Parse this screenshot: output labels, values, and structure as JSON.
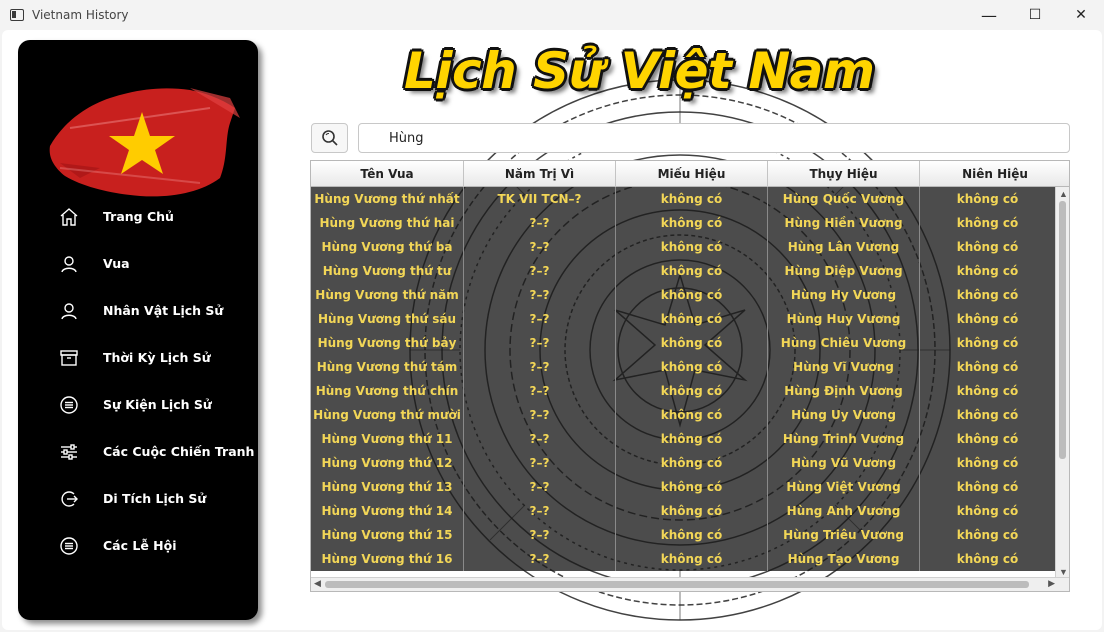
{
  "window": {
    "title": "Vietnam History",
    "minimize": "—",
    "maximize": "☐",
    "close": "✕"
  },
  "header": {
    "title": "Lịch Sử Việt Nam"
  },
  "sidebar": {
    "items": [
      {
        "label": "Trang Chủ",
        "icon": "home-icon"
      },
      {
        "label": "Vua",
        "icon": "user-icon"
      },
      {
        "label": "Nhân Vật Lịch Sử",
        "icon": "user-icon"
      },
      {
        "label": "Thời Kỳ Lịch Sử",
        "icon": "archive-icon"
      },
      {
        "label": "Sự Kiện Lịch Sử",
        "icon": "list-circle-icon"
      },
      {
        "label": "Các Cuộc Chiến Tranh",
        "icon": "sliders-icon"
      },
      {
        "label": "Di Tích Lịch Sử",
        "icon": "exit-circle-icon"
      },
      {
        "label": "Các Lễ Hội",
        "icon": "list-circle-icon"
      }
    ]
  },
  "search": {
    "value": "Hùng",
    "icon": "search-icon"
  },
  "table": {
    "columns": [
      "Tên Vua",
      "Năm Trị Vì",
      "Miếu Hiệu",
      "Thụy Hiệu",
      "Niên Hiệu"
    ],
    "rows": [
      [
        "Hùng Vương thứ nhất",
        "TK VII TCN–?",
        "không có",
        "Hùng Quốc Vương",
        "không có"
      ],
      [
        "Hùng Vương thứ hai",
        "?–?",
        "không có",
        "Hùng Hiền Vương",
        "không có"
      ],
      [
        "Hùng Vương thứ ba",
        "?–?",
        "không có",
        "Hùng Lân Vương",
        "không có"
      ],
      [
        "Hùng Vương thứ tư",
        "?–?",
        "không có",
        "Hùng Diệp Vương",
        "không có"
      ],
      [
        "Hùng Vương thứ năm",
        "?–?",
        "không có",
        "Hùng Hy Vương",
        "không có"
      ],
      [
        "Hùng Vương thứ sáu",
        "?–?",
        "không có",
        "Hùng Huy Vương",
        "không có"
      ],
      [
        "Hùng Vương thứ bảy",
        "?–?",
        "không có",
        "Hùng Chiêu Vương",
        "không có"
      ],
      [
        "Hùng Vương thứ tám",
        "?–?",
        "không có",
        "Hùng Vĩ Vương",
        "không có"
      ],
      [
        "Hùng Vương thứ chín",
        "?–?",
        "không có",
        "Hùng Định Vương",
        "không có"
      ],
      [
        "Hùng Vương thứ mười",
        "?–?",
        "không có",
        "Hùng Uy Vương",
        "không có"
      ],
      [
        "Hùng Vương thứ 11",
        "?–?",
        "không có",
        "Hùng Trinh Vương",
        "không có"
      ],
      [
        "Hùng Vương thứ 12",
        "?–?",
        "không có",
        "Hùng Vũ Vương",
        "không có"
      ],
      [
        "Hùng Vương thứ 13",
        "?–?",
        "không có",
        "Hùng Việt Vương",
        "không có"
      ],
      [
        "Hùng Vương thứ 14",
        "?–?",
        "không có",
        "Hùng Anh Vương",
        "không có"
      ],
      [
        "Hùng Vương thứ 15",
        "?–?",
        "không có",
        "Hùng Triêu Vương",
        "không có"
      ],
      [
        "Hùng Vương thứ 16",
        "?–?",
        "không có",
        "Hùng Tạo Vương",
        "không có"
      ]
    ]
  },
  "colors": {
    "sidebar_bg": "#000000",
    "title_yellow": "#ffd400",
    "cell_text": "#f2d657",
    "flag_red": "#c8201e",
    "star_yellow": "#ffcc00"
  }
}
